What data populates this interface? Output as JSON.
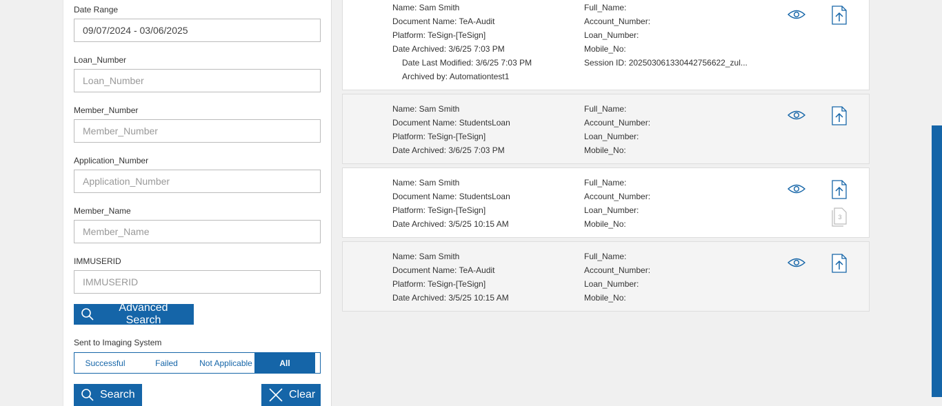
{
  "filters": {
    "date_range": {
      "label": "Date Range",
      "value": "09/07/2024 - 03/06/2025"
    },
    "loan_number": {
      "label": "Loan_Number",
      "placeholder": "Loan_Number"
    },
    "member_number": {
      "label": "Member_Number",
      "placeholder": "Member_Number"
    },
    "application_number": {
      "label": "Application_Number",
      "placeholder": "Application_Number"
    },
    "member_name": {
      "label": "Member_Name",
      "placeholder": "Member_Name"
    },
    "immuserid": {
      "label": "IMMUSERID",
      "placeholder": "IMMUSERID"
    },
    "advanced_search_label": "Advanced Search",
    "sent_to_imaging_label": "Sent to Imaging System",
    "imaging_options": [
      "Successful",
      "Failed",
      "Not Applicable",
      "All"
    ],
    "imaging_selected": "All",
    "search_label": "Search",
    "clear_label": "Clear"
  },
  "results": [
    {
      "name": "Name: Sam Smith",
      "document": "Document Name: TeA-Audit",
      "platform": "Platform: TeSign-[TeSign]",
      "archived": "Date Archived: 3/6/25 7:03 PM",
      "modified": "Date Last Modified: 3/6/25 7:03 PM",
      "archived_by": "Archived by: Automationtest1",
      "full_name": "Full_Name:",
      "account_number": "Account_Number:",
      "loan_number": "Loan_Number:",
      "mobile_no": "Mobile_No:",
      "session_id": "Session ID: 20250306133044275662​2_zul..."
    },
    {
      "name": "Name: Sam Smith",
      "document": "Document Name: StudentsLoan",
      "platform": "Platform: TeSign-[TeSign]",
      "archived": "Date Archived: 3/6/25 7:03 PM",
      "full_name": "Full_Name:",
      "account_number": "Account_Number:",
      "loan_number": "Loan_Number:",
      "mobile_no": "Mobile_No:"
    },
    {
      "name": "Name: Sam Smith",
      "document": "Document Name: StudentsLoan",
      "platform": "Platform: TeSign-[TeSign]",
      "archived": "Date Archived: 3/5/25 10:15 AM",
      "full_name": "Full_Name:",
      "account_number": "Account_Number:",
      "loan_number": "Loan_Number:",
      "mobile_no": "Mobile_No:",
      "pages_badge": "3"
    },
    {
      "name": "Name: Sam Smith",
      "document": "Document Name: TeA-Audit",
      "platform": "Platform: TeSign-[TeSign]",
      "archived": "Date Archived: 3/5/25 10:15 AM",
      "full_name": "Full_Name:",
      "account_number": "Account_Number:",
      "loan_number": "Loan_Number:",
      "mobile_no": "Mobile_No:"
    }
  ],
  "icons": {
    "view": "eye-icon",
    "upload": "upload-document-icon",
    "pages": "document-pages-icon",
    "search": "search-icon",
    "clear": "close-icon"
  },
  "colors": {
    "accent": "#1565a8",
    "background": "#f0f0f0"
  }
}
